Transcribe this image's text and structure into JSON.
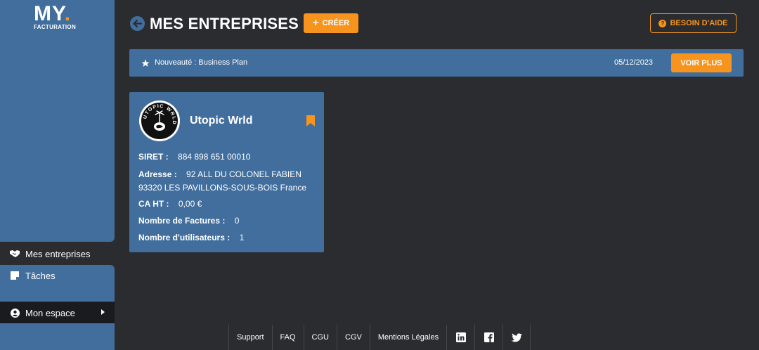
{
  "logo": {
    "brand": "MY",
    "dot": ".",
    "subtitle": "FACTURATION"
  },
  "sidebar": {
    "items": [
      {
        "label": "Mes entreprises",
        "icon": "handshake-icon"
      },
      {
        "label": "Tâches",
        "icon": "note-icon"
      },
      {
        "label": "Mon espace",
        "icon": "user-circle-icon"
      }
    ]
  },
  "header": {
    "title": "MES ENTREPRISES",
    "create_label": "CRÉER",
    "help_label": "BESOIN D'AIDE"
  },
  "news": {
    "text": "Nouveauté : Business Plan",
    "date": "05/12/2023",
    "button_label": "VOIR PLUS"
  },
  "company": {
    "name": "Utopic Wrld",
    "siret_label": "SIRET :",
    "siret": "884 898 651 00010",
    "address_label": "Adresse :",
    "address_line1": "92 ALL DU COLONEL FABIEN",
    "address_line2": "93320 LES PAVILLONS-SOUS-BOIS France",
    "ca_label": "CA HT :",
    "ca": "0,00 €",
    "invoices_label": "Nombre de Factures :",
    "invoices": "0",
    "users_label": "Nombre d'utilisateurs :",
    "users": "1",
    "logo_text": "UTOPIC WRLD"
  },
  "footer": {
    "links": [
      "Support",
      "FAQ",
      "CGU",
      "CGV",
      "Mentions Légales"
    ],
    "social": [
      "linkedin-icon",
      "facebook-icon",
      "twitter-icon"
    ]
  },
  "colors": {
    "primary": "#416e9d",
    "accent": "#f7941d",
    "background": "#2b2c30"
  }
}
